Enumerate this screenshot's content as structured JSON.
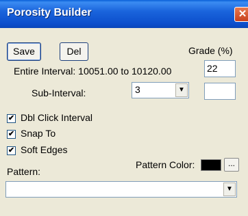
{
  "window": {
    "title": "Porosity Builder",
    "close_glyph": "✕"
  },
  "toolbar": {
    "save_label": "Save",
    "del_label": "Del"
  },
  "grade": {
    "label": "Grade (%)",
    "value": "22"
  },
  "interval": {
    "label": "Entire Interval: 10051.00 to 10120.00"
  },
  "subinterval": {
    "label": "Sub-Interval:",
    "selected": "3",
    "extra_value": ""
  },
  "options": [
    {
      "label": "Dbl Click Interval",
      "checked": true
    },
    {
      "label": "Snap To",
      "checked": true
    },
    {
      "label": "Soft Edges",
      "checked": true
    }
  ],
  "pattern": {
    "label": "Pattern:",
    "selected": "",
    "color_label": "Pattern Color:",
    "color": "#000000",
    "browse_label": "..."
  },
  "glyphs": {
    "check": "✔",
    "dropdown": "▼"
  }
}
